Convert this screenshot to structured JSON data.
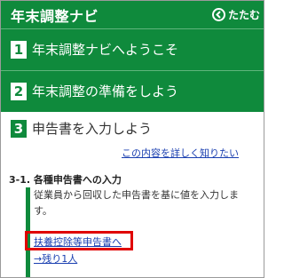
{
  "header": {
    "title": "年末調整ナビ",
    "collapse_label": "たたむ"
  },
  "steps": [
    {
      "number": "1",
      "label": "年末調整ナビへようこそ"
    },
    {
      "number": "2",
      "label": "年末調整の準備をしよう"
    },
    {
      "number": "3",
      "label": "申告書を入力しよう"
    }
  ],
  "detail_link": "この内容を詳しく知りたい",
  "section": {
    "title": "3-1. 各種申告書への入力",
    "description": "従業員から回収した申告書を基に値を入力します。",
    "form_link": "扶養控除等申告書へ",
    "remaining_link": "→残り1人"
  },
  "colors": {
    "primary_green": "#0f8a3c",
    "link_blue": "#1a3fb0",
    "highlight_red": "#e00000"
  }
}
